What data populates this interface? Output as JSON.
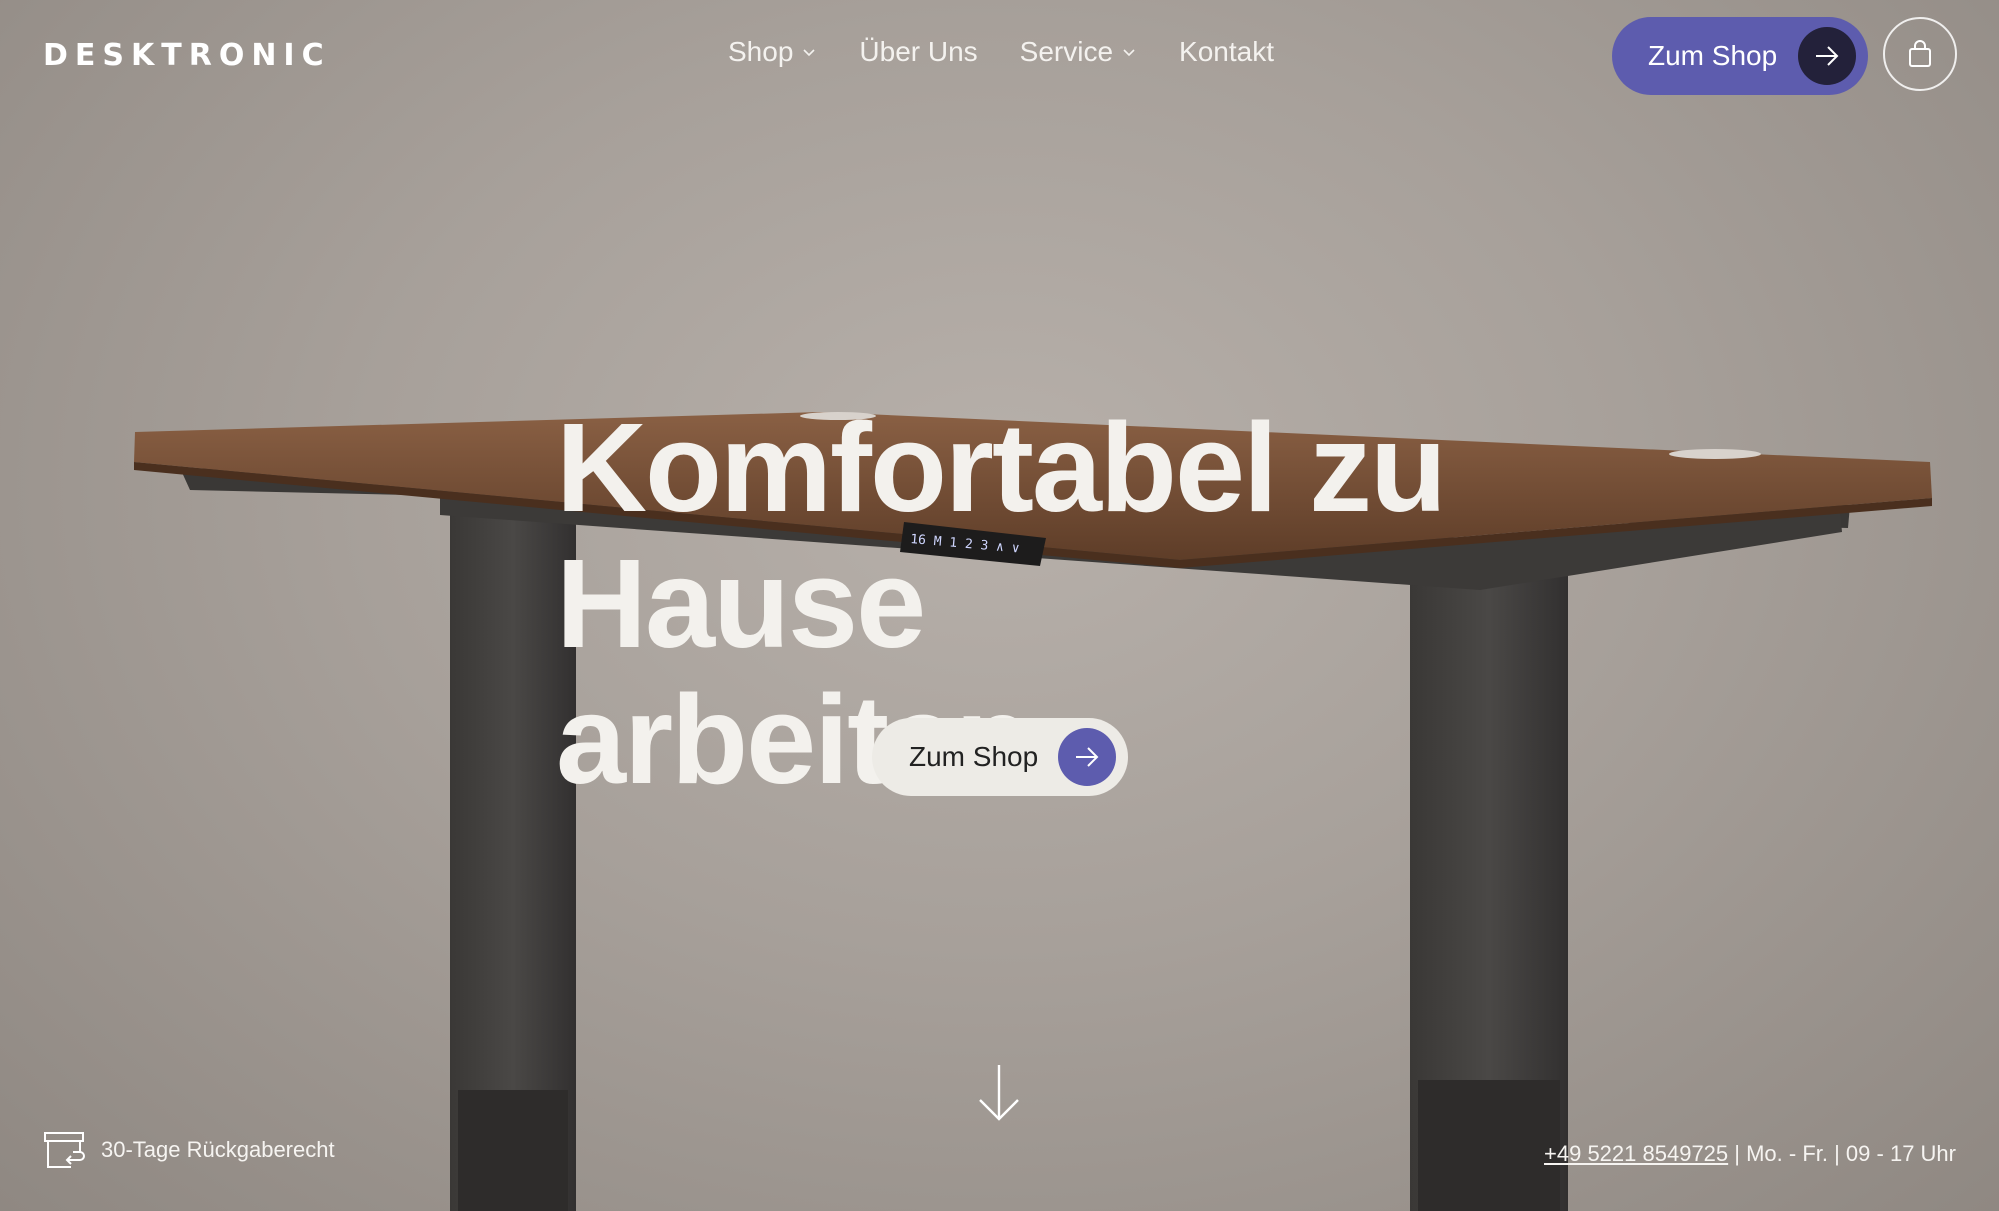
{
  "brand": {
    "logo_text": "DESKTRONIC"
  },
  "nav": {
    "items": [
      {
        "label": "Shop",
        "has_dropdown": true
      },
      {
        "label": "Über Uns",
        "has_dropdown": false
      },
      {
        "label": "Service",
        "has_dropdown": true
      },
      {
        "label": "Kontakt",
        "has_dropdown": false
      }
    ]
  },
  "header": {
    "cta_label": "Zum Shop",
    "cart_icon": "shopping-bag-icon"
  },
  "hero": {
    "headline_line1": "Komfortabel zu",
    "headline_line2": "Hause arbeiten.",
    "cta_label": "Zum Shop",
    "scroll_icon": "arrow-down-icon",
    "desk_display": "16 M 1 2 3 ∧ ∨"
  },
  "footer": {
    "return_policy": "30-Tage Rückgaberecht",
    "return_icon": "return-box-icon",
    "phone": "+49 5221 8549725",
    "hours": "| Mo. - Fr. | 09 - 17 Uhr"
  },
  "colors": {
    "accent": "#5d5cae",
    "dark_circle": "#23213a",
    "light_button": "#edebe6",
    "background": "#a9a29c",
    "desk_wood": "#6e4a32",
    "desk_frame": "#3d3b39"
  }
}
